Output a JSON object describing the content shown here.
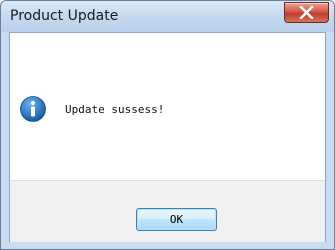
{
  "window": {
    "title": "Product Update",
    "close_icon": "close-icon",
    "close_color": "#c9463a"
  },
  "dialog": {
    "icon": "info-icon",
    "icon_color": "#1e6fc4",
    "message": "Update sussess!"
  },
  "buttons": {
    "ok_label": "OK"
  }
}
